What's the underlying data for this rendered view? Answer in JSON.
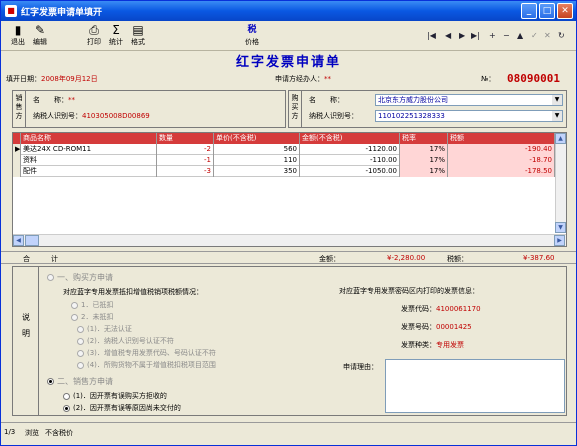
{
  "window": {
    "title": "红字发票申请单填开"
  },
  "toolbar": {
    "exit": "退出",
    "edit": "编辑",
    "print": "打印",
    "stats": "统计",
    "format": "格式",
    "price": "价格",
    "price_icon": "税"
  },
  "header": {
    "doc_title": "红字发票申请单",
    "date_label": "填开日期：",
    "date_value": "2008年09月12日",
    "agent_label": "申请方经办人：",
    "agent_value": "**",
    "no_label": "№：",
    "no_value": "08090001"
  },
  "seller": {
    "side": "销售方",
    "name_label": "名　　称：",
    "name_value": "**",
    "tax_label": "纳税人识别号：",
    "tax_value": "410305008D00869"
  },
  "buyer": {
    "side": "购买方",
    "name_label": "名　　称：",
    "name_value": "北京东方威力股份公司",
    "tax_label": "纳税人识别号：",
    "tax_value": "110102251328333"
  },
  "grid": {
    "headers": [
      "商品名称",
      "数量",
      "单价(不含税)",
      "金额(不含税)",
      "税率",
      "税额"
    ],
    "rows": [
      {
        "name": "美达24X CD-ROM11",
        "qty": "-2",
        "price": "560",
        "amount": "-1120.00",
        "rate": "17%",
        "tax": "-190.40"
      },
      {
        "name": "资料",
        "qty": "-1",
        "price": "110",
        "amount": "-110.00",
        "rate": "17%",
        "tax": "-18.70"
      },
      {
        "name": "配件",
        "qty": "-3",
        "price": "350",
        "amount": "-1050.00",
        "rate": "17%",
        "tax": "-178.50"
      }
    ]
  },
  "totals": {
    "label": "合　　　计",
    "amount_label": "金额：",
    "amount_value": "¥-2,280.00",
    "tax_label": "税额：",
    "tax_value": "¥-387.60"
  },
  "explain": {
    "side": "说明",
    "buyer_apply": "一、购买方申请",
    "buyer_question": "对应蓝字专用发票抵扣增值税销项税额情况：",
    "opt_deducted": "1．已抵扣",
    "opt_not_deducted": "2．未抵扣",
    "sub1": "(1)．无法认证",
    "sub2": "(2)．纳税人识别号认证不符",
    "sub3": "(3)．增值税专用发票代码、号码认证不符",
    "sub4": "(4)．所购货物不属于增值税扣税项目范围",
    "seller_apply": "二、销售方申请",
    "seller_opt1": "(1)．因开票有误购买方拒收的",
    "seller_opt2": "(2)．因开票有误等原因尚未交付的",
    "info_title": "对应蓝字专用发票密码区内打印的发票信息：",
    "code_label": "发票代码：",
    "code_value": "4100061170",
    "number_label": "发票号码：",
    "number_value": "00001425",
    "kind_label": "发票种类：",
    "kind_value": "专用发票",
    "reason_label": "申请理由："
  },
  "status": {
    "page": "1/3",
    "mode": "浏览",
    "tax_mode": "不含税价"
  },
  "colors": {
    "title_blue": "#0000c0",
    "red": "#c00000",
    "grid_header": "#d53b3b"
  }
}
